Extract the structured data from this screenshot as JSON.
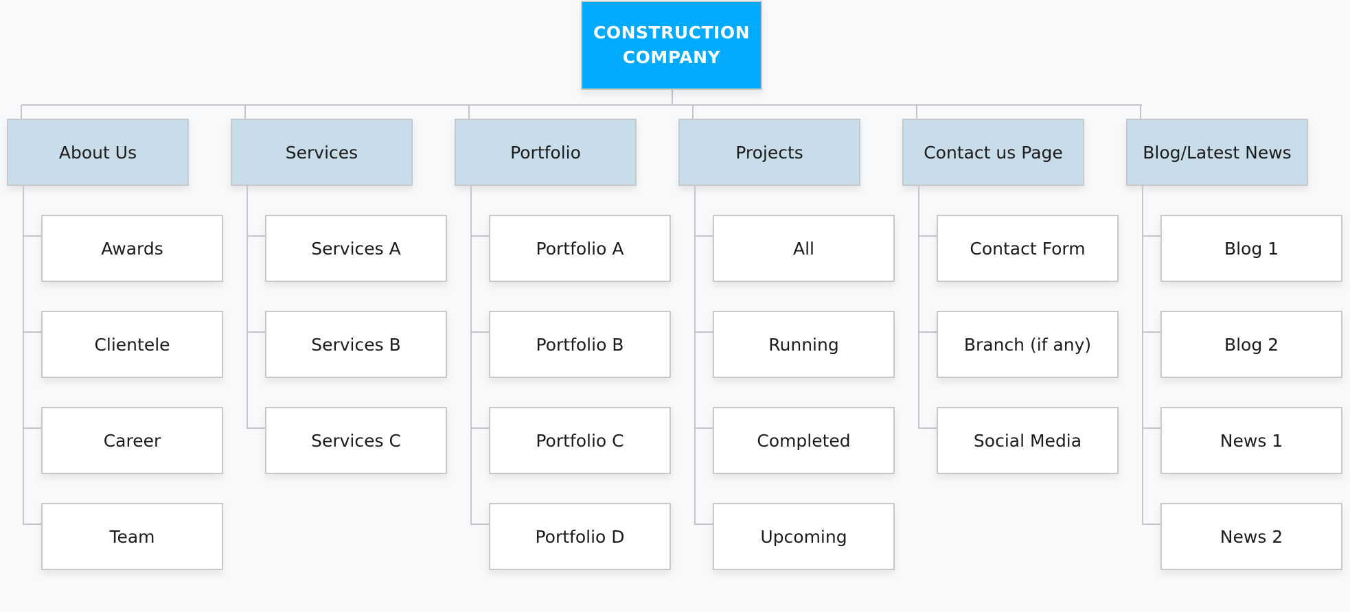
{
  "root": {
    "line1": "CONSTRUCTION",
    "line2": "COMPANY",
    "color": "#00aaff"
  },
  "colors": {
    "parent_fill": "#c8dde9",
    "child_fill": "#ffffff",
    "connector": "#c4c6c9",
    "background": "#f8f9fb"
  },
  "columns": [
    {
      "label": "About Us",
      "children": [
        "Awards",
        "Clientele",
        "Career",
        "Team"
      ]
    },
    {
      "label": "Services",
      "children": [
        "Services A",
        "Services B",
        "Services C"
      ]
    },
    {
      "label": "Portfolio",
      "children": [
        "Portfolio A",
        "Portfolio B",
        "Portfolio C",
        "Portfolio D"
      ]
    },
    {
      "label": "Projects",
      "children": [
        "All",
        "Running",
        "Completed",
        "Upcoming"
      ]
    },
    {
      "label": "Contact us Page",
      "children": [
        "Contact Form",
        "Branch (if any)",
        "Social Media"
      ]
    },
    {
      "label": "Blog/Latest News",
      "children": [
        "Blog 1",
        "Blog 2",
        "News 1",
        "News 2"
      ]
    }
  ]
}
